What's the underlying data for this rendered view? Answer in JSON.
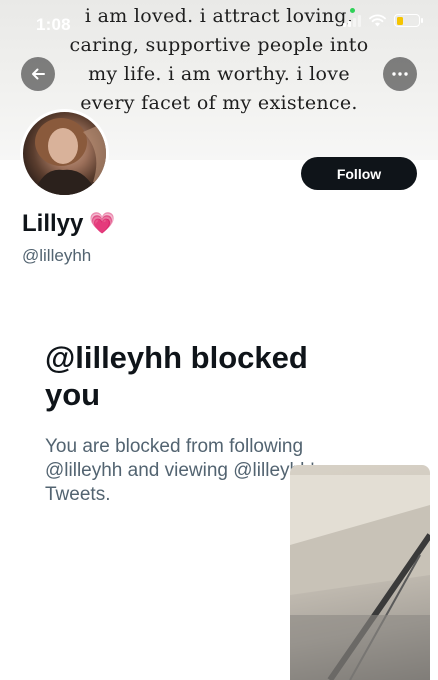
{
  "status_bar": {
    "time": "1:08"
  },
  "banner": {
    "quote_lines": [
      "i am loved. i attract loving,",
      "caring, supportive people into",
      "my life. i am worthy. i love",
      "every facet of my existence."
    ]
  },
  "nav": {
    "back_icon": "arrow-left-icon",
    "more_icon": "more-horizontal-icon"
  },
  "profile": {
    "display_name": "Lillyy",
    "name_emoji": "💗",
    "handle": "@lilleyhh",
    "follow_label": "Follow"
  },
  "blocked": {
    "title": "@lilleyhh blocked you",
    "description": "You are blocked from following @lilleyhh and viewing @lilleyhh's Tweets."
  },
  "colors": {
    "follow_bg": "#0f1419",
    "secondary_text": "#536471",
    "battery_fill": "#f5c400"
  }
}
